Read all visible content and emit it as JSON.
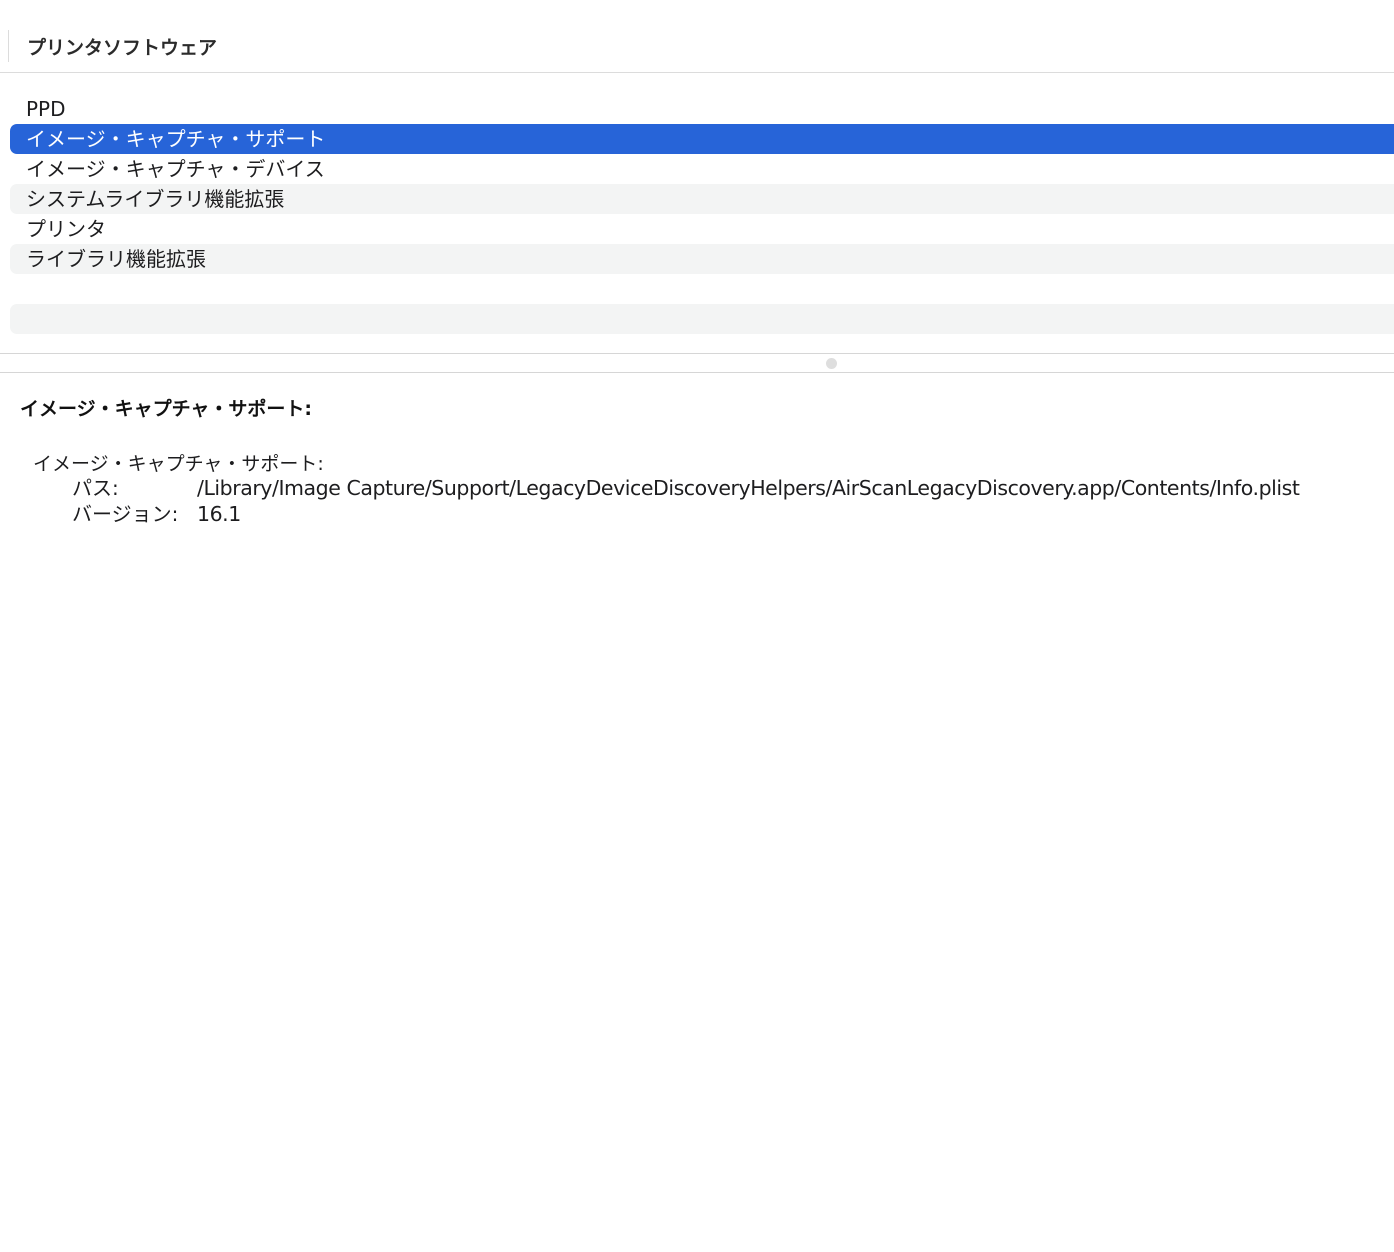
{
  "list": {
    "column_title": "プリンタソフトウェア",
    "items": [
      {
        "label": "PPD",
        "state": "normal"
      },
      {
        "label": "イメージ・キャプチャ・サポート",
        "state": "selected"
      },
      {
        "label": "イメージ・キャプチャ・デバイス",
        "state": "normal"
      },
      {
        "label": "システムライブラリ機能拡張",
        "state": "alt"
      },
      {
        "label": "プリンタ",
        "state": "normal"
      },
      {
        "label": "ライブラリ機能拡張",
        "state": "alt"
      }
    ]
  },
  "detail": {
    "heading": "イメージ・キャプチャ・サポート:",
    "sub_heading": "イメージ・キャプチャ・サポート:",
    "path_label": "パス:",
    "path_value": "/Library/Image Capture/Support/LegacyDeviceDiscoveryHelpers/AirScanLegacyDiscovery.app/Contents/Info.plist",
    "version_label": "バージョン:",
    "version_value": "16.1"
  },
  "colors": {
    "selection": "#2764d8",
    "alternate_row": "#f3f4f4"
  }
}
